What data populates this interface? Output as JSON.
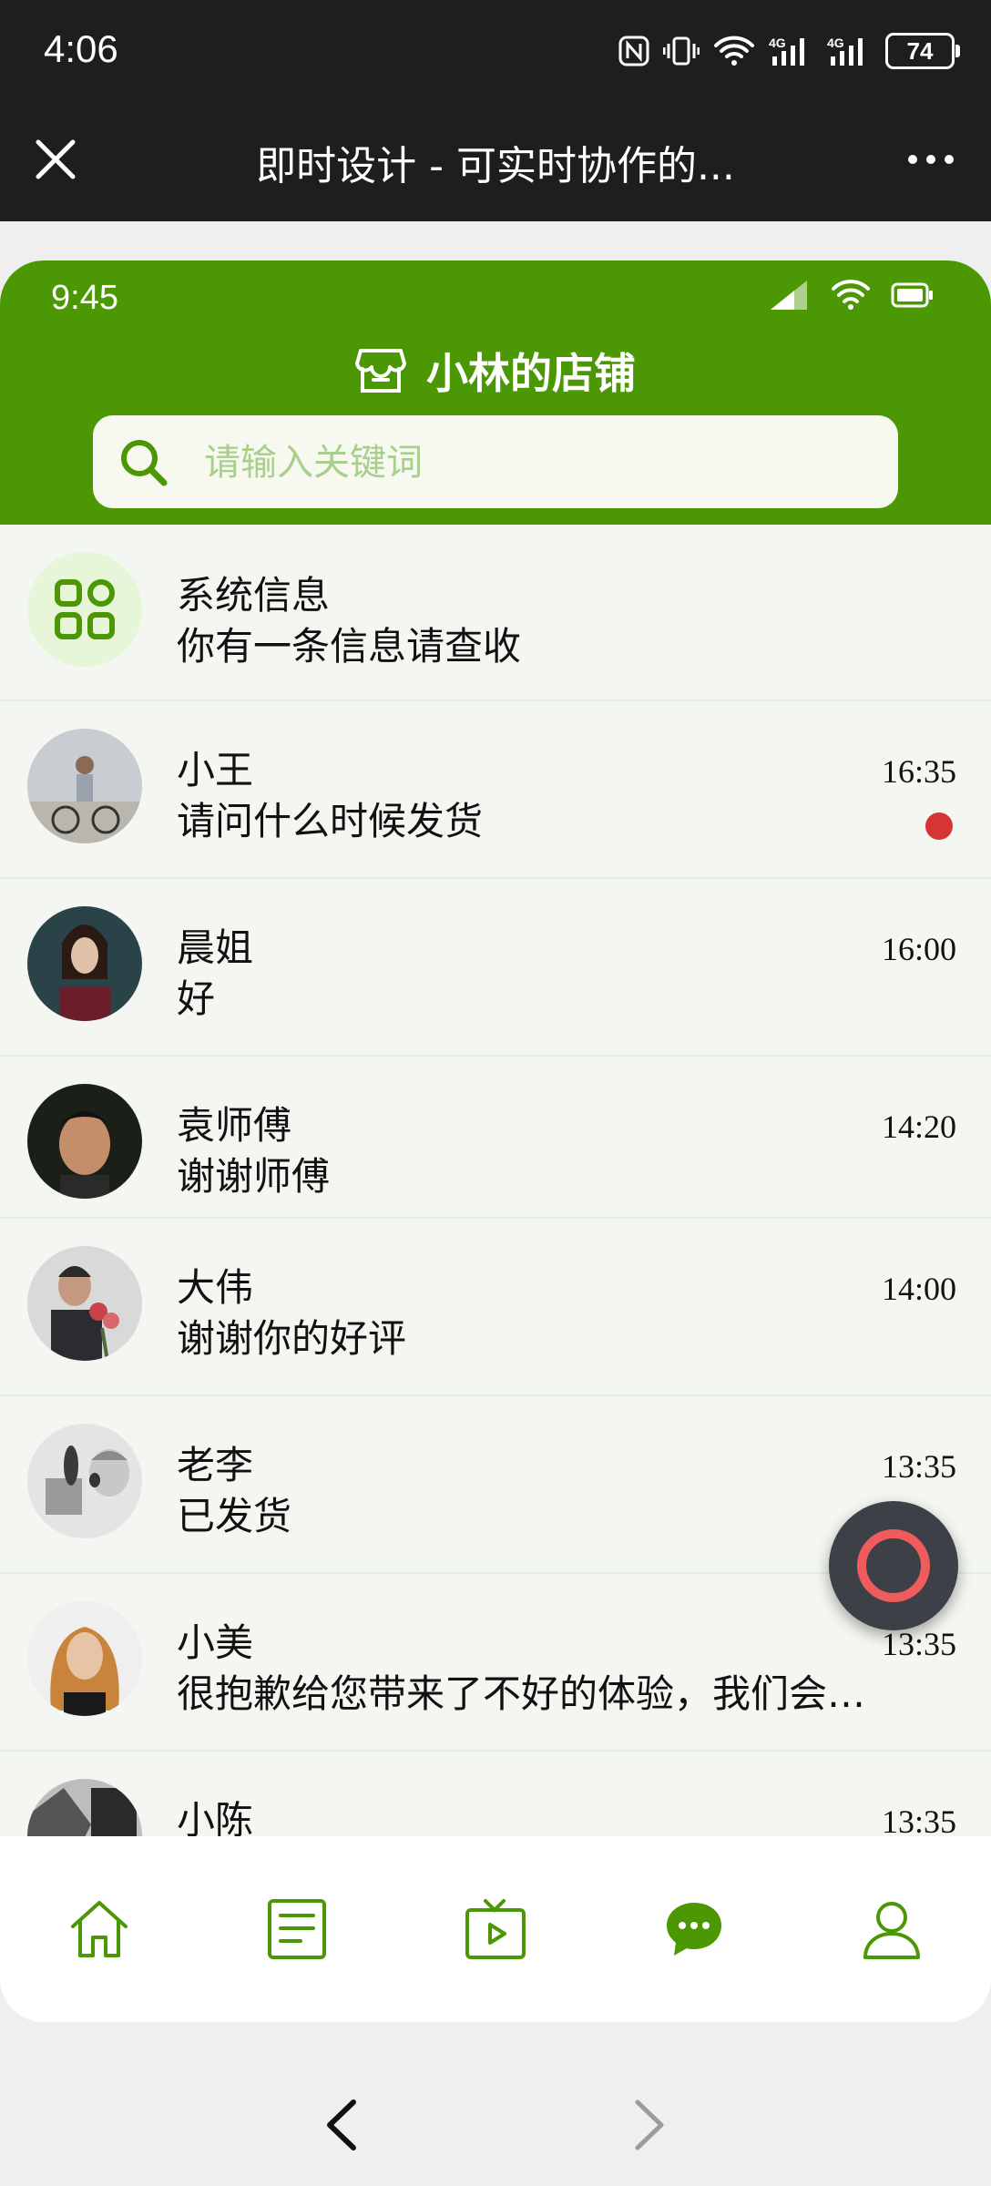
{
  "os": {
    "time": "4:06",
    "battery": "74",
    "title": "即时设计 - 可实时协作的..."
  },
  "app": {
    "time": "9:45",
    "store_name": "小林的店铺",
    "search_placeholder": "请输入关键词"
  },
  "system_message": {
    "title": "系统信息",
    "text": "你有一条信息请查收"
  },
  "conversations": [
    {
      "name": "小王",
      "message": "请问什么时候发货",
      "time": "16:35",
      "unread": true
    },
    {
      "name": "晨姐",
      "message": "好",
      "time": "16:00",
      "unread": false
    },
    {
      "name": "袁师傅",
      "message": "谢谢师傅",
      "time": "14:20",
      "unread": false
    },
    {
      "name": "大伟",
      "message": "谢谢你的好评",
      "time": "14:00",
      "unread": false
    },
    {
      "name": "老李",
      "message": "已发货",
      "time": "13:35",
      "unread": false
    },
    {
      "name": "小美",
      "message": "很抱歉给您带来了不好的体验，我们会…",
      "time": "13:35",
      "unread": false
    },
    {
      "name": "小陈",
      "message": "",
      "time": "13:35",
      "unread": false
    }
  ],
  "tabs": [
    {
      "icon": "home-icon"
    },
    {
      "icon": "document-icon"
    },
    {
      "icon": "video-icon"
    },
    {
      "icon": "chat-icon",
      "active": true
    },
    {
      "icon": "user-icon"
    }
  ],
  "colors": {
    "brand_green": "#4b9704",
    "unread_dot": "#d73434",
    "fab_ring": "#f05c5c"
  }
}
